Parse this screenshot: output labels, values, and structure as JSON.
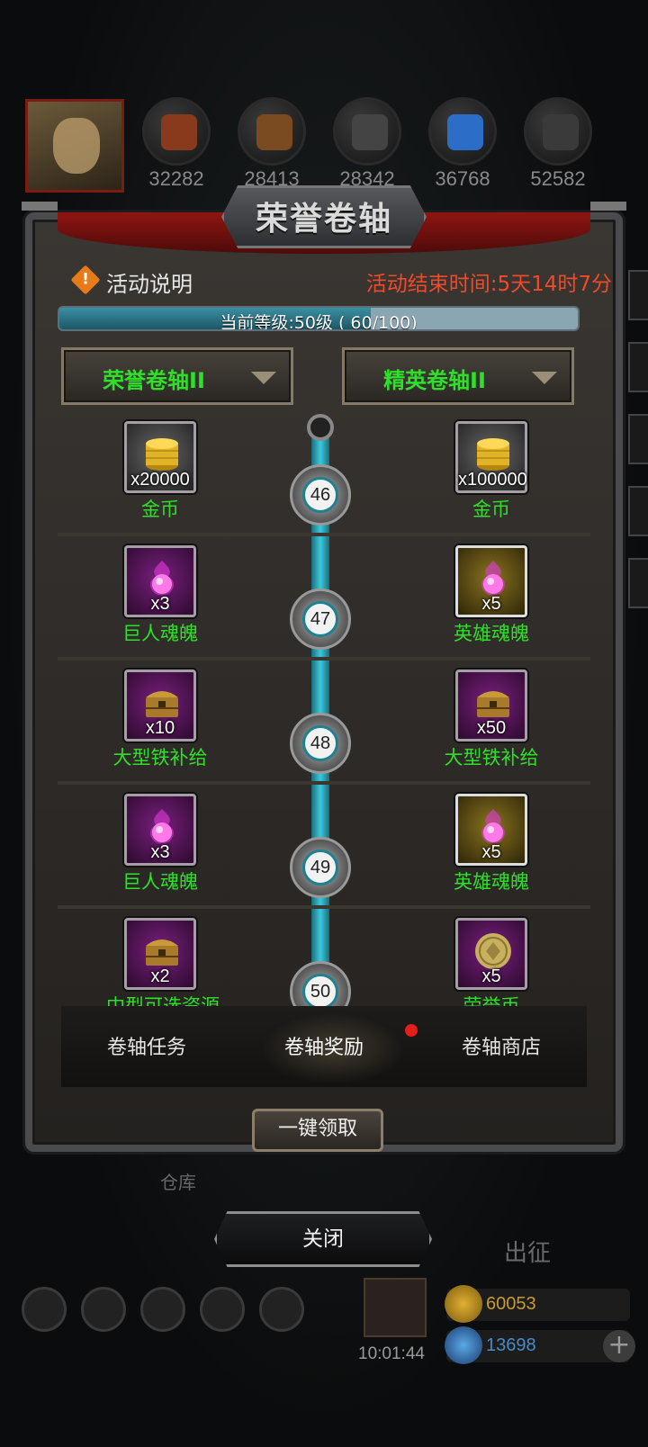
{
  "resources": [
    {
      "name": "wood-icon",
      "value": "32282",
      "color": "#8a3a1c"
    },
    {
      "name": "planks-icon",
      "value": "28413",
      "color": "#7a4a20"
    },
    {
      "name": "iron-bars-icon",
      "value": "28342",
      "color": "#444444"
    },
    {
      "name": "crystal-icon",
      "value": "36768",
      "color": "#2c6dc8"
    },
    {
      "name": "ore-icon",
      "value": "52582",
      "color": "#3a3a3a"
    }
  ],
  "dialog": {
    "title": "荣誉卷轴",
    "info_label": "活动说明",
    "end_time": "活动结束时间:5天14时7分",
    "progress": {
      "text": "当前等级:50级 ( 60/100)",
      "current": 60,
      "max": 100
    },
    "left_selector": "荣誉卷轴II",
    "right_selector": "精英卷轴II",
    "rows": [
      {
        "level": "46",
        "left": {
          "name": "金币",
          "count": "x20000",
          "type": "gold-coins-icon",
          "frame": "gray"
        },
        "right": {
          "name": "金币",
          "count": "x100000",
          "type": "gold-coins-icon",
          "frame": "gray"
        }
      },
      {
        "level": "47",
        "left": {
          "name": "巨人魂魄",
          "count": "x3",
          "type": "soul-orb-icon",
          "frame": "purple"
        },
        "right": {
          "name": "英雄魂魄",
          "count": "x5",
          "type": "soul-orb-icon",
          "frame": "gold"
        }
      },
      {
        "level": "48",
        "left": {
          "name": "大型铁补给",
          "count": "x10",
          "type": "chest-icon",
          "frame": "purple"
        },
        "right": {
          "name": "大型铁补给",
          "count": "x50",
          "type": "chest-icon",
          "frame": "purple"
        }
      },
      {
        "level": "49",
        "left": {
          "name": "巨人魂魄",
          "count": "x3",
          "type": "soul-orb-icon",
          "frame": "purple"
        },
        "right": {
          "name": "英雄魂魄",
          "count": "x5",
          "type": "soul-orb-icon",
          "frame": "gold"
        }
      },
      {
        "level": "50",
        "left": {
          "name": "中型可选资源",
          "count": "x2",
          "type": "chest-icon",
          "frame": "purple"
        },
        "right": {
          "name": "荣誉币",
          "count": "x5",
          "type": "honor-coin-icon",
          "frame": "purple"
        }
      }
    ],
    "tabs": [
      "卷轴任务",
      "卷轴奖励",
      "卷轴商店"
    ],
    "active_tab": 1,
    "claim_all": "一键领取"
  },
  "close_label": "关闭",
  "background": {
    "warehouse": "仓库",
    "sortie": "出征",
    "clock": "10:01:44",
    "gold": "60053",
    "gems": "13698"
  },
  "colors": {
    "reward_name": "#2fe02a",
    "end_time": "#ef4a2a",
    "progress_fill": "#1c5766",
    "curtain": "#8e1512"
  }
}
